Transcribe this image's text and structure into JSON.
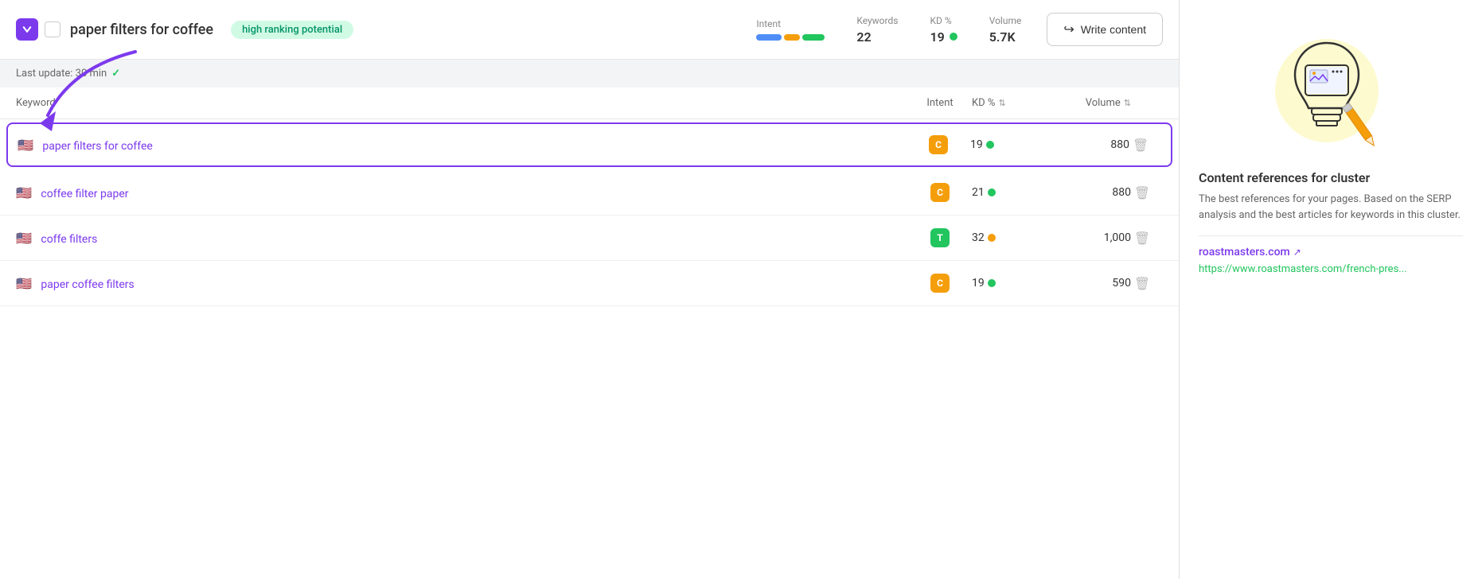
{
  "header": {
    "title": "paper filters for coffee",
    "badge": "high ranking potential",
    "intent_label": "Intent",
    "keywords_label": "Keywords",
    "keywords_value": "22",
    "kd_label": "KD %",
    "kd_value": "19",
    "volume_label": "Volume",
    "volume_value": "5.7K",
    "write_btn": "Write content"
  },
  "last_update": {
    "text": "Last update: 30 min"
  },
  "table": {
    "col_keyword": "Keyword",
    "col_intent": "Intent",
    "col_kd": "KD %",
    "col_volume": "Volume",
    "rows": [
      {
        "keyword": "paper filters for coffee",
        "flag": "🇺🇸",
        "intent": "C",
        "intent_type": "c",
        "kd": "19",
        "kd_dot": "green",
        "volume": "880",
        "selected": true
      },
      {
        "keyword": "coffee filter paper",
        "flag": "🇺🇸",
        "intent": "C",
        "intent_type": "c",
        "kd": "21",
        "kd_dot": "green",
        "volume": "880",
        "selected": false
      },
      {
        "keyword": "coffe filters",
        "flag": "🇺🇸",
        "intent": "T",
        "intent_type": "t",
        "kd": "32",
        "kd_dot": "yellow",
        "volume": "1,000",
        "selected": false
      },
      {
        "keyword": "paper coffee filters",
        "flag": "🇺🇸",
        "intent": "C",
        "intent_type": "c",
        "kd": "19",
        "kd_dot": "green",
        "volume": "590",
        "selected": false
      }
    ]
  },
  "right_panel": {
    "title": "Content references for cluster",
    "description": "The best references for your pages. Based on the SERP analysis and the best articles for keywords in this cluster.",
    "link_text": "roastmasters.com",
    "link_url": "https://www.roastmasters.com/french-pres..."
  }
}
